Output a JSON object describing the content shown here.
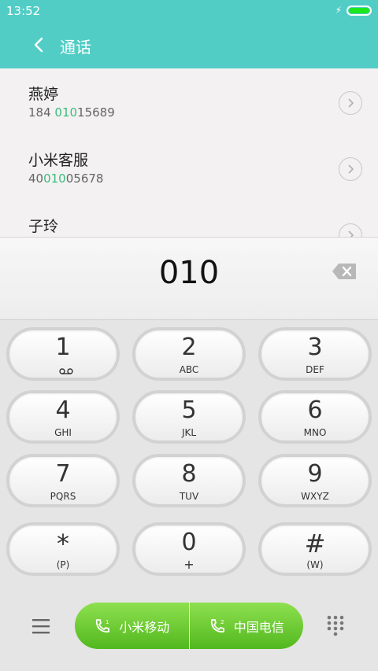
{
  "status_bar": {
    "time": "13:52"
  },
  "header": {
    "title": "通话"
  },
  "results": [
    {
      "name": "燕婷",
      "num_pre": "184 ",
      "num_match": "010",
      "num_post": "15689"
    },
    {
      "name": "小米客服",
      "num_pre": "40",
      "num_match": "010",
      "num_post": "05678"
    },
    {
      "name": "子玲",
      "num_pre": "",
      "num_match": "",
      "num_post": ""
    }
  ],
  "dialer": {
    "input": "010"
  },
  "keys": [
    {
      "digit": "1",
      "letters": ""
    },
    {
      "digit": "2",
      "letters": "ABC"
    },
    {
      "digit": "3",
      "letters": "DEF"
    },
    {
      "digit": "4",
      "letters": "GHI"
    },
    {
      "digit": "5",
      "letters": "JKL"
    },
    {
      "digit": "6",
      "letters": "MNO"
    },
    {
      "digit": "7",
      "letters": "PQRS"
    },
    {
      "digit": "8",
      "letters": "TUV"
    },
    {
      "digit": "9",
      "letters": "WXYZ"
    },
    {
      "digit": "*",
      "letters": "(P)"
    },
    {
      "digit": "0",
      "letters": "+"
    },
    {
      "digit": "#",
      "letters": "(W)"
    }
  ],
  "sims": [
    {
      "slot": "1",
      "label": "小米移动"
    },
    {
      "slot": "2",
      "label": "中国电信"
    }
  ],
  "colors": {
    "header_bg": "#51cdc5",
    "match": "#3dbb7a",
    "call_button": "#6bc934"
  }
}
